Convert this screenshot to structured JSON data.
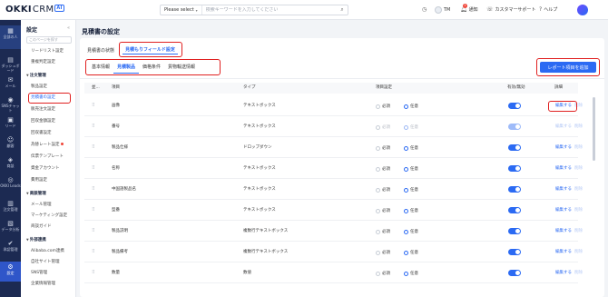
{
  "app": {
    "logo_main": "OKKI",
    "logo_sub": "CRM",
    "logo_badge": "AI"
  },
  "header": {
    "search_scope": "Please select",
    "search_placeholder": "検索キーワードを入力してください",
    "user_initials": "TM",
    "notifications_label": "通知",
    "notifications_count": "2",
    "support_label": "カスタマーサポート",
    "help_label": "ヘルプ"
  },
  "leftnav": {
    "items": [
      {
        "label": "全部の人",
        "icon": "dashboard-icon"
      },
      {
        "label": "ダッシュボード",
        "icon": "chart-icon"
      },
      {
        "label": "メール",
        "icon": "mail-icon"
      },
      {
        "label": "SNSチャット",
        "icon": "chat-icon"
      },
      {
        "label": "リード",
        "icon": "lead-icon"
      },
      {
        "label": "顧客",
        "icon": "customer-icon"
      },
      {
        "label": "商談",
        "icon": "deal-icon"
      },
      {
        "label": "OKKI Leads",
        "icon": "leads-icon"
      },
      {
        "label": "注文管理",
        "icon": "order-icon"
      },
      {
        "label": "データ分析",
        "icon": "analytics-icon"
      },
      {
        "label": "承認管理",
        "icon": "approval-icon"
      },
      {
        "label": "設定",
        "icon": "settings-icon"
      }
    ]
  },
  "submenu": {
    "title": "設定",
    "search_placeholder": "このページを探す",
    "items_top": [
      "リードリスト設定",
      "重複判定設定"
    ],
    "group1": "注文管理",
    "group1_items": [
      "製品設定",
      "見積書の設定",
      "販売注文設定",
      "回収金額設定",
      "回収書設定",
      "為替レート設定",
      "伝票テンプレート",
      "資金アカウント",
      "費用設定"
    ],
    "group2": "商談管理",
    "group2_items": [
      "メール管理",
      "マーケティング設定",
      "商談ガイド"
    ],
    "group3": "外部連携",
    "group3_items": [
      "Alibaba.com連携",
      "自社サイト管理",
      "SNS管理",
      "企業情報管理"
    ]
  },
  "page": {
    "title": "見積書の設定",
    "status_label": "見積書の状態",
    "field_setting_label": "見積もりフィールド設定",
    "tabs": [
      "基本情報",
      "見積製品",
      "価格条件",
      "貨物輸送情報"
    ],
    "add_button": "レポート項目を追加"
  },
  "table": {
    "headers": {
      "order": "並...",
      "item": "項目",
      "type": "タイプ",
      "setting": "項目設定",
      "enabled": "有効/無効",
      "detail": "詳細"
    },
    "required_label": "必須",
    "optional_label": "任意",
    "edit_label": "編集する",
    "delete_label": "削除",
    "rows": [
      {
        "item": "画像",
        "type": "テキストボックス",
        "selected": "optional",
        "locked": false
      },
      {
        "item": "番号",
        "type": "テキストボックス",
        "selected": "optional",
        "locked": true
      },
      {
        "item": "製品仕様",
        "type": "ドロップダウン",
        "selected": "optional",
        "locked": false
      },
      {
        "item": "名称",
        "type": "テキストボックス",
        "selected": "optional",
        "locked": false
      },
      {
        "item": "中国語製品名",
        "type": "テキストボックス",
        "selected": "optional",
        "locked": false
      },
      {
        "item": "型番",
        "type": "テキストボックス",
        "selected": "optional",
        "locked": false
      },
      {
        "item": "製品説明",
        "type": "複数行テキストボックス",
        "selected": "optional",
        "locked": false
      },
      {
        "item": "製品備考",
        "type": "複数行テキストボックス",
        "selected": "optional",
        "locked": false
      },
      {
        "item": "数量",
        "type": "数値",
        "selected": "optional",
        "locked": false
      }
    ]
  },
  "colors": {
    "primary": "#2b6af3",
    "nav_bg": "#1c2a52",
    "highlight": "#e02020"
  }
}
